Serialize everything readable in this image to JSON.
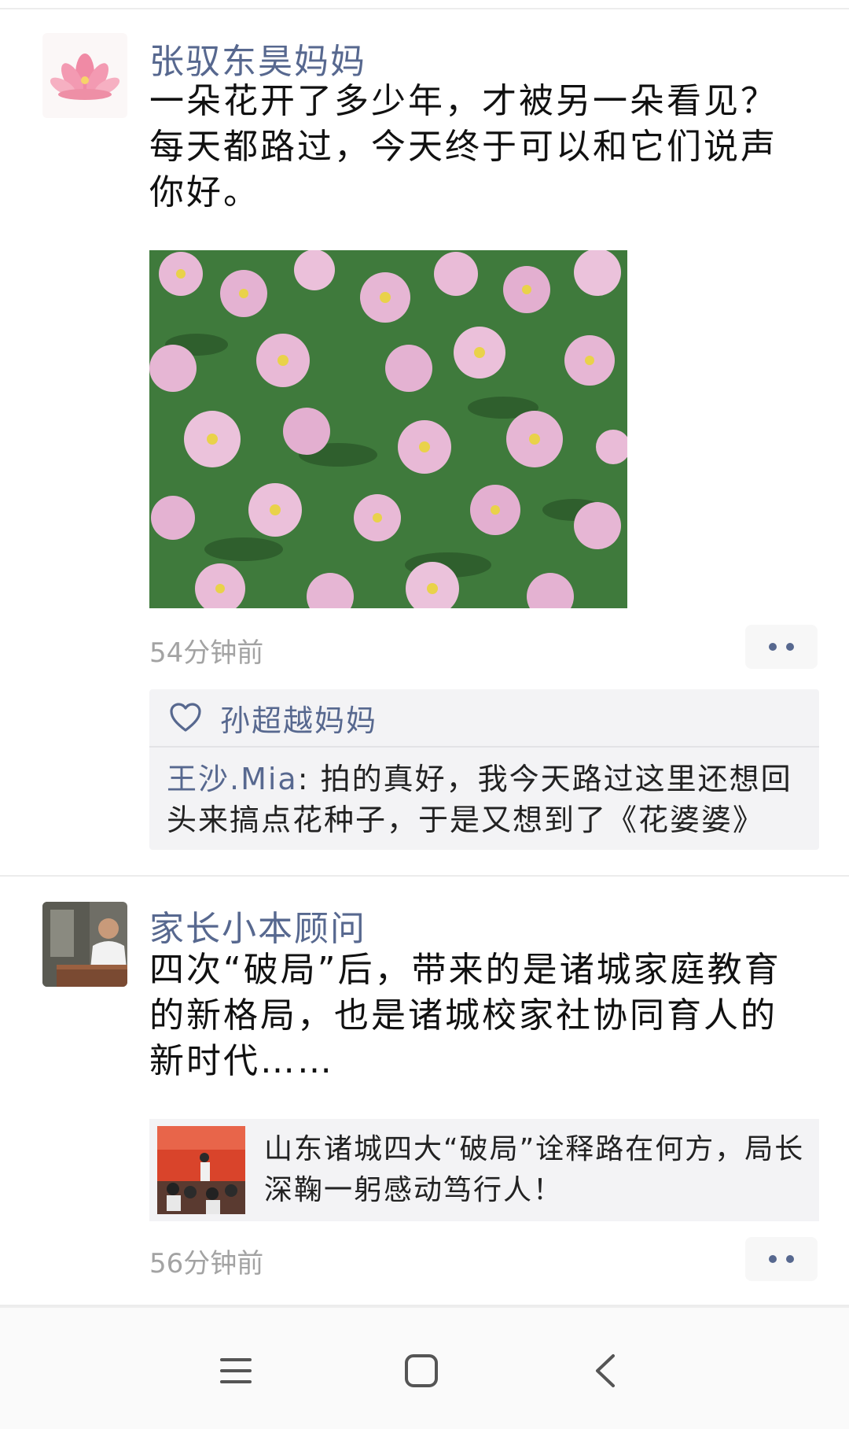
{
  "posts": [
    {
      "nickname": "张驭东昊妈妈",
      "text": "一朵花开了多少年，才被另一朵看见？每天都路过，今天终于可以和它们说声你好。",
      "time": "54分钟前",
      "likes": "孙超越妈妈",
      "comment_author": "王沙.Mia",
      "comment_sep": ": ",
      "comment_text": "拍的真好，我今天路过这里还想回头来搞点花种子，于是又想到了《花婆婆》"
    },
    {
      "nickname": "家长小本顾问",
      "text": "四次“破局”后，带来的是诸城家庭教育的新格局，也是诸城校家社协同育人的新时代……",
      "link_title": "山东诸城四大“破局”诠释路在何方，局长深鞠一躬感动笃行人！",
      "time": "56分钟前"
    }
  ],
  "icons": {
    "like": "heart-icon",
    "more": "more-dots-icon",
    "nav_menu": "menu-icon",
    "nav_home": "home-square-icon",
    "nav_back": "back-chevron-icon"
  },
  "colors": {
    "name_blue": "#57688f",
    "timestamp_gray": "#a3a3a3",
    "box_bg": "#f3f3f5"
  }
}
